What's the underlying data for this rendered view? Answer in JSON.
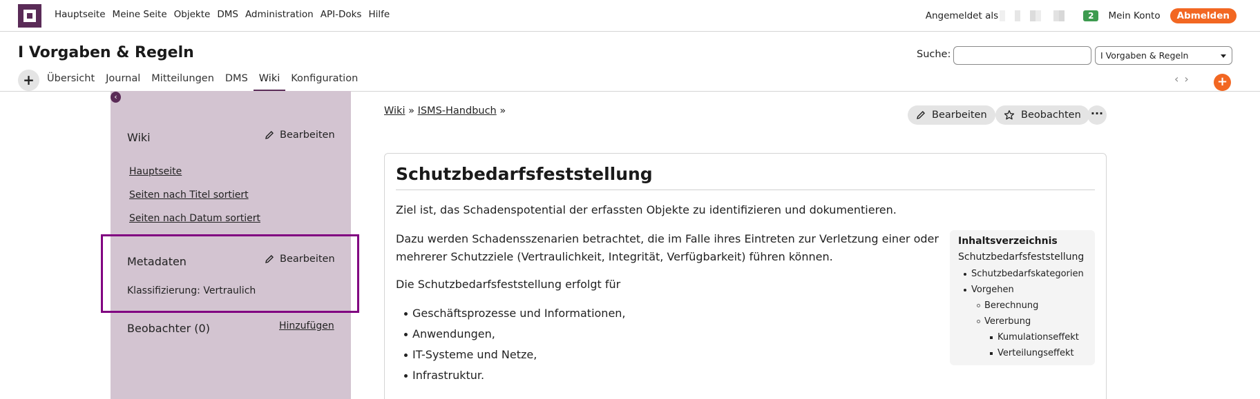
{
  "topnav": [
    "Hauptseite",
    "Meine Seite",
    "Objekte",
    "DMS",
    "Administration",
    "API-Doks",
    "Hilfe"
  ],
  "account": {
    "logged_in_label": "Angemeldet als",
    "notification_count": "2",
    "my_account": "Mein Konto",
    "logout": "Abmelden"
  },
  "header": {
    "title": "I Vorgaben & Regeln",
    "search_label": "Suche:",
    "search_value": "",
    "project_select": "I Vorgaben & Regeln"
  },
  "tabs": [
    {
      "label": "Übersicht",
      "active": false
    },
    {
      "label": "Journal",
      "active": false
    },
    {
      "label": "Mitteilungen",
      "active": false
    },
    {
      "label": "DMS",
      "active": false
    },
    {
      "label": "Wiki",
      "active": true
    },
    {
      "label": "Konfiguration",
      "active": false
    }
  ],
  "sidebar": {
    "wiki_title": "Wiki",
    "edit_label": "Bearbeiten",
    "links": [
      "Hauptseite",
      "Seiten nach Titel sortiert",
      "Seiten nach Datum sortiert"
    ],
    "metadata_title": "Metadaten",
    "classification": "Klassifizierung: Vertraulich",
    "watchers_title": "Beobachter (0)",
    "add_label": "Hinzufügen"
  },
  "breadcrumb": {
    "wiki": "Wiki",
    "sep": "»",
    "page": "ISMS-Handbuch"
  },
  "actions": {
    "edit": "Bearbeiten",
    "watch": "Beobachten",
    "more": "···"
  },
  "content": {
    "title": "Schutzbedarfsfeststellung",
    "p1": "Ziel ist, das Schadenspotential der erfassten Objekte zu identifizieren und dokumentieren.",
    "p2_line1": "Dazu werden Schadensszenarien betrachtet, die im Falle ihres Eintreten zur Verletzung einer oder",
    "p2_line2": "mehrerer Schutzziele (Vertraulichkeit, Integrität, Verfügbarkeit) führen können.",
    "p3": "Die Schutzbedarfsfeststellung erfolgt für",
    "bullets": [
      "Geschäftsprozesse und Informationen,",
      "Anwendungen,",
      "IT-Systeme und Netze,",
      "Infrastruktur."
    ]
  },
  "toc": {
    "title": "Inhaltsverzeichnis",
    "root": "Schutzbedarfsfeststellung",
    "items": [
      "Schutzbedarfskategorien",
      "Vorgehen",
      "Berechnung",
      "Vererbung",
      "Kumulationseffekt",
      "Verteilungseffekt"
    ]
  },
  "colors": {
    "brand": "#5a2b57",
    "accent": "#f26722",
    "sidebar_bg": "#d3c4d1",
    "highlight": "#800080",
    "badge": "#3d9b4f"
  }
}
